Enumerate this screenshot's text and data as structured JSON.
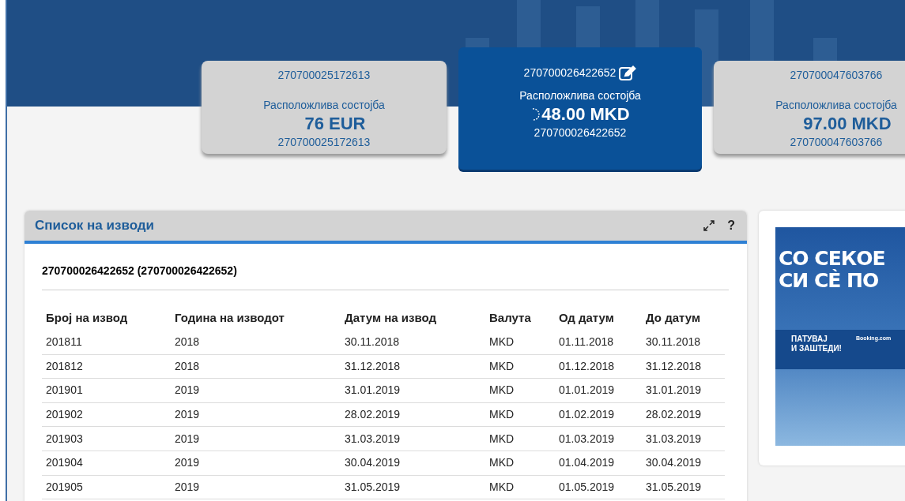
{
  "accounts": [
    {
      "number": "270700025172613",
      "label": "Расположлива состојба",
      "balance": "76 EUR",
      "subnumber": "270700025172613",
      "selected": false
    },
    {
      "number": "270700026422652",
      "label": "Расположлива состојба",
      "balance": "48.00 MKD",
      "subnumber": "270700026422652",
      "selected": true
    },
    {
      "number": "270700047603766",
      "label": "Расположлива состојба",
      "balance": "97.00 MKD",
      "subnumber": "270700047603766",
      "selected": false
    }
  ],
  "panel": {
    "title": "Список на изводи",
    "help": "?",
    "account_heading": "270700026422652 (270700026422652)",
    "table": {
      "columns": [
        "Број на извод",
        "Година на изводот",
        "Датум на извод",
        "Валута",
        "Од датум",
        "До датум"
      ],
      "rows": [
        [
          "201811",
          "2018",
          "30.11.2018",
          "MKD",
          "01.11.2018",
          "30.11.2018"
        ],
        [
          "201812",
          "2018",
          "31.12.2018",
          "MKD",
          "01.12.2018",
          "31.12.2018"
        ],
        [
          "201901",
          "2019",
          "31.01.2019",
          "MKD",
          "01.01.2019",
          "31.01.2019"
        ],
        [
          "201902",
          "2019",
          "28.02.2019",
          "MKD",
          "01.02.2019",
          "28.02.2019"
        ],
        [
          "201903",
          "2019",
          "31.03.2019",
          "MKD",
          "01.03.2019",
          "31.03.2019"
        ],
        [
          "201904",
          "2019",
          "30.04.2019",
          "MKD",
          "01.04.2019",
          "30.04.2019"
        ],
        [
          "201905",
          "2019",
          "31.05.2019",
          "MKD",
          "01.05.2019",
          "31.05.2019"
        ]
      ]
    }
  },
  "ad": {
    "headline": [
      "СО СЕКОЕ",
      "СИ СЀ ПО"
    ],
    "slogan": [
      "ПАТУВАЈ",
      "И ЗАШТЕДИ!"
    ],
    "brand": "Booking.com"
  }
}
